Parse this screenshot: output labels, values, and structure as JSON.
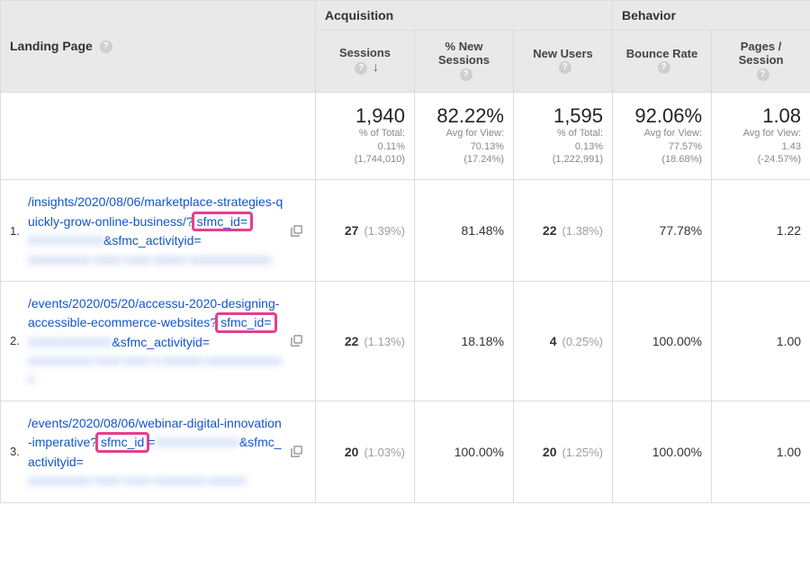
{
  "headers": {
    "landing_page": "Landing Page",
    "group_acquisition": "Acquisition",
    "group_behavior": "Behavior",
    "sessions": "Sessions",
    "pct_new_sessions": "% New Sessions",
    "new_users": "New Users",
    "bounce_rate": "Bounce Rate",
    "pages_per_session": "Pages / Session"
  },
  "summary": {
    "sessions": {
      "value": "1,940",
      "sub1": "% of Total:",
      "sub2": "0.11%",
      "sub3": "(1,744,010)"
    },
    "pct_new_sessions": {
      "value": "82.22%",
      "sub1": "Avg for View:",
      "sub2": "70.13%",
      "sub3": "(17.24%)"
    },
    "new_users": {
      "value": "1,595",
      "sub1": "% of Total:",
      "sub2": "0.13%",
      "sub3": "(1,222,991)"
    },
    "bounce_rate": {
      "value": "92.06%",
      "sub1": "Avg for View:",
      "sub2": "77.57%",
      "sub3": "(18.68%)"
    },
    "pages_per_session": {
      "value": "1.08",
      "sub1": "Avg for View:",
      "sub2": "1.43",
      "sub3": "(-24.57%)"
    }
  },
  "rows": [
    {
      "idx": "1.",
      "url_parts": {
        "pre": "/insights/2020/08/06/marketplace-strategies-quickly-grow-online-business/?",
        "hl": "sfmc_id=",
        "post": "",
        "blur1": "XXXXXXXXX",
        "mid": "&sfmc_activityid=",
        "blur2": "xxxxxxxxxx-xxxx-xxxx-xxxxx-xxxxxxxxxxxxx"
      },
      "sessions": {
        "n": "27",
        "pct": "(1.39%)"
      },
      "pct_new_sessions": "81.48%",
      "new_users": {
        "n": "22",
        "pct": "(1.38%)"
      },
      "bounce_rate": "77.78%",
      "pages_per_session": "1.22"
    },
    {
      "idx": "2.",
      "url_parts": {
        "pre": "/events/2020/05/20/accessu-2020-designing-accessible-ecommerce-websites?",
        "hl": "sfmc_id=",
        "post": "",
        "blur1": "XXXXXXXXXX",
        "mid": "&sfmc_activityid=",
        "blur2": "xxxxxxxxxx-xxxx-xxxx-x-xxxxxx-xxxxxxxxxxxxx"
      },
      "sessions": {
        "n": "22",
        "pct": "(1.13%)"
      },
      "pct_new_sessions": "18.18%",
      "new_users": {
        "n": "4",
        "pct": "(0.25%)"
      },
      "bounce_rate": "100.00%",
      "pages_per_session": "1.00"
    },
    {
      "idx": "3.",
      "url_parts": {
        "pre": "/events/2020/08/06/webinar-digital-innovation-imperative?",
        "hl": "sfmc_id",
        "post": "=",
        "blur1": "XXXXXXXXXX",
        "mid": "&sfmc_activityid=",
        "blur2": "xxxxxxxxxx-xxxx-xxxx-xxxxxxxx-xxxxxx"
      },
      "sessions": {
        "n": "20",
        "pct": "(1.03%)"
      },
      "pct_new_sessions": "100.00%",
      "new_users": {
        "n": "20",
        "pct": "(1.25%)"
      },
      "bounce_rate": "100.00%",
      "pages_per_session": "1.00"
    }
  ]
}
